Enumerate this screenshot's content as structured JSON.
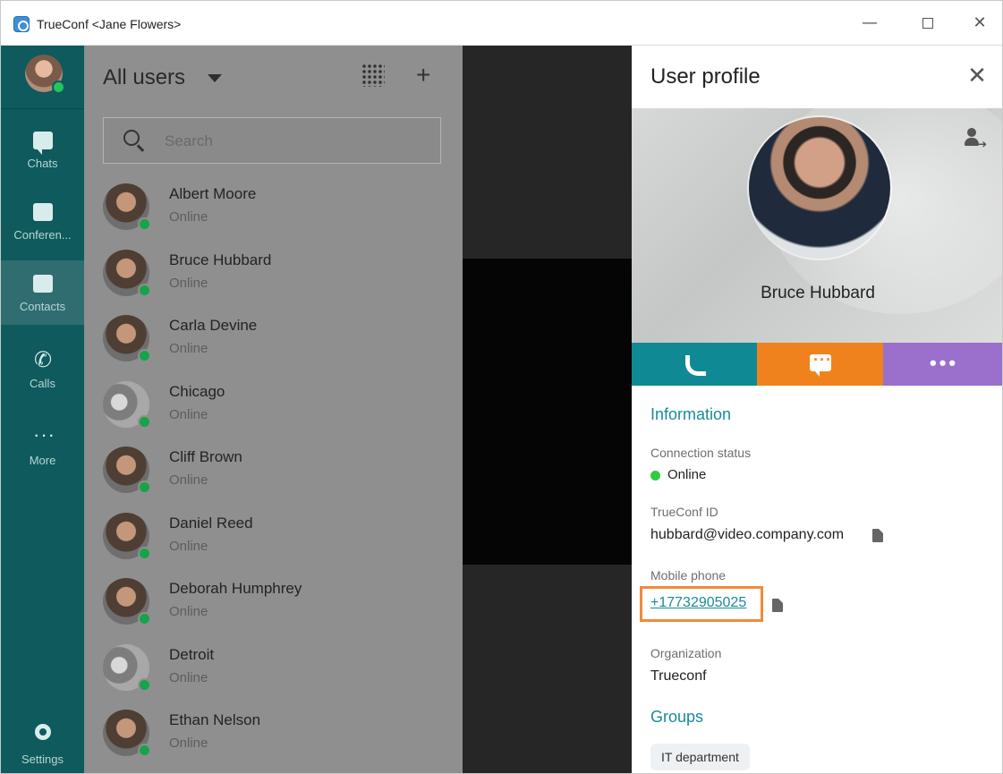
{
  "window": {
    "title": "TrueConf <Jane Flowers>"
  },
  "rail": {
    "items": [
      {
        "label": "Chats"
      },
      {
        "label": "Conferen..."
      },
      {
        "label": "Contacts"
      },
      {
        "label": "Calls"
      },
      {
        "label": "More"
      }
    ],
    "settings_label": "Settings"
  },
  "contacts": {
    "title": "All users",
    "search_placeholder": "Search",
    "rows": [
      {
        "name": "Albert Moore",
        "status": "Online"
      },
      {
        "name": "Bruce Hubbard",
        "status": "Online"
      },
      {
        "name": "Carla Devine",
        "status": "Online"
      },
      {
        "name": "Chicago",
        "status": "Online"
      },
      {
        "name": "Cliff Brown",
        "status": "Online"
      },
      {
        "name": "Daniel Reed",
        "status": "Online"
      },
      {
        "name": "Deborah Humphrey",
        "status": "Online"
      },
      {
        "name": "Detroit",
        "status": "Online"
      },
      {
        "name": "Ethan Nelson",
        "status": "Online"
      }
    ]
  },
  "profile": {
    "title": "User profile",
    "name": "Bruce Hubbard",
    "information_label": "Information",
    "connection_status_label": "Connection status",
    "connection_status_value": "Online",
    "trueconf_id_label": "TrueConf ID",
    "trueconf_id_value": "hubbard@video.company.com",
    "mobile_phone_label": "Mobile phone",
    "mobile_phone_value": "+17732905025",
    "organization_label": "Organization",
    "organization_value": "Trueconf",
    "groups_label": "Groups",
    "groups": [
      "IT department"
    ]
  },
  "colors": {
    "rail": "#0e5a5c",
    "accent": "#1a8a9a",
    "call": "#0f8a94",
    "chat": "#f0821e",
    "more": "#9b6fcc",
    "online": "#2ecc40",
    "highlight": "#f08a3c"
  }
}
